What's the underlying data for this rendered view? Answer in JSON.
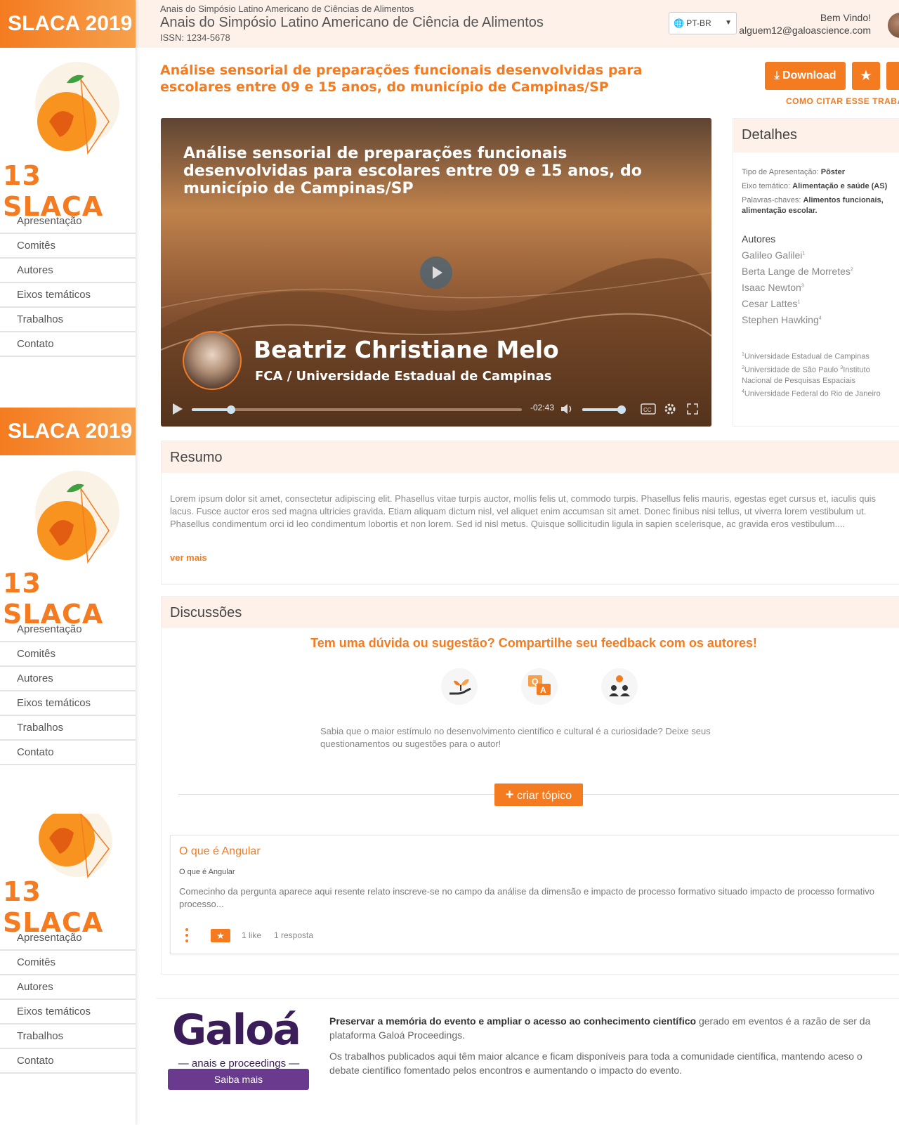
{
  "sidebar": {
    "blocks": [
      {
        "banner": "SLACA 2019",
        "logo_text": "13 SLACA"
      },
      {
        "banner": "SLACA 2019",
        "logo_text": "13 SLACA"
      },
      {
        "banner": "",
        "logo_text": "13 SLACA"
      }
    ],
    "menu": [
      "Apresentação",
      "Comitês",
      "Autores",
      "Eixos temáticos",
      "Trabalhos",
      "Contato"
    ]
  },
  "header": {
    "small_title": "Anais do Simpósio Latino Americano de Ciências de Alimentos",
    "title": "Anais do Simpósio Latino Americano de Ciência de Alimentos",
    "issn": "ISSN: 1234-5678",
    "language": "PT-BR",
    "welcome": "Bem Vindo!",
    "email": "alguem12@galoascience.com"
  },
  "paper": {
    "title": "Análise sensorial de preparações funcionais desenvolvidas para escolares entre 09 e 15 anos, do município de Campinas/SP",
    "download_label": "Download",
    "cite_label": "COMO CITAR ESSE TRABALHO"
  },
  "video": {
    "title": "Análise sensorial de preparações funcionais desenvolvidas para escolares entre 09 e 15 anos, do município de Campinas/SP",
    "speaker": "Beatriz Christiane Melo",
    "affiliation": "FCA / Universidade Estadual de Campinas",
    "time_remaining": "-02:43",
    "progress": 0.12,
    "volume": 0.9
  },
  "details": {
    "heading": "Detalhes",
    "tipo_label": "Tipo de Apresentação:",
    "tipo_value": "Pôster",
    "eixo_label": "Eixo temático:",
    "eixo_value": "Alimentação e saúde (AS)",
    "palavras_label": "Palavras-chaves:",
    "palavras_value": "Alimentos funcionais,",
    "palavras_value2": "alimentação escolar.",
    "authors_heading": "Autores",
    "authors": [
      {
        "name": "Galileo Galilei",
        "sup": "1"
      },
      {
        "name": "Berta Lange de Morretes",
        "sup": "2"
      },
      {
        "name": "Isaac Newton",
        "sup": "3"
      },
      {
        "name": "Cesar Lattes",
        "sup": "1"
      },
      {
        "name": "Stephen Hawking",
        "sup": "4"
      }
    ],
    "institutions": {
      "i1": "Universidade Estadual de Campinas",
      "i2": "Universidade de São Paulo",
      "i3": "Instituto Nacional de Pesquisas Espaciais",
      "i4": "Universidade Federal do Rio de Janeiro"
    }
  },
  "resumo": {
    "heading": "Resumo",
    "text": "Lorem ipsum dolor sit amet, consectetur adipiscing elit. Phasellus vitae turpis auctor, mollis felis ut, commodo turpis. Phasellus felis mauris, egestas eget cursus et, iaculis quis lacus. Fusce auctor eros sed magna ultricies gravida. Etiam aliquam dictum nisl, vel aliquet enim accumsan sit amet. Donec finibus nisi tellus, ut viverra lorem vestibulum ut. Phasellus condimentum orci id leo condimentum lobortis et non lorem. Sed id nisl metus. Quisque sollicitudin ligula in sapien scelerisque, ac gravida eros vestibulum....",
    "more": "ver mais"
  },
  "discussoes": {
    "heading": "Discussões",
    "cta": "Tem uma dúvida ou sugestão? Compartilhe seu feedback com os autores!",
    "text": "Sabia que o maior estímulo no desenvolvimento científico e cultural é a curiosidade? Deixe seus questionamentos ou sugestões para o autor!",
    "create_topic": "criar tópico",
    "topic": {
      "title": "O que é Angular",
      "subtitle": "O que é Angular",
      "body": "Comecinho da pergunta aparece aqui resente relato inscreve-se no campo da análise da dimensão e impacto de processo formativo situado impacto de processo formativo processo...",
      "likes": "1 like",
      "replies": "1 resposta"
    }
  },
  "footer": {
    "brand": "Galoá",
    "brand_sub": "anais e proceedings",
    "saiba_mais": "Saiba mais",
    "p1_bold": "Preservar a memória do evento e ampliar o acesso ao conhecimento científico",
    "p1_rest": " gerado em eventos é a razão de ser da plataforma Galoá Proceedings.",
    "p2": "Os trabalhos publicados aqui têm maior alcance e ficam disponíveis para toda a comunidade científica, mantendo aceso o debate científico fomentado pelos encontros e aumentando o impacto do evento."
  },
  "colors": {
    "accent": "#f47b20",
    "header_bg": "#fdf1ea",
    "brand_purple": "#3b1d59"
  },
  "icons": [
    "globe-icon",
    "download-icon",
    "star-icon",
    "share-icon",
    "play-icon",
    "volume-icon",
    "captions-icon",
    "settings-icon",
    "fullscreen-icon",
    "plant-hand-icon",
    "qa-icon",
    "people-icon",
    "plus-icon",
    "more-vertical-icon"
  ]
}
